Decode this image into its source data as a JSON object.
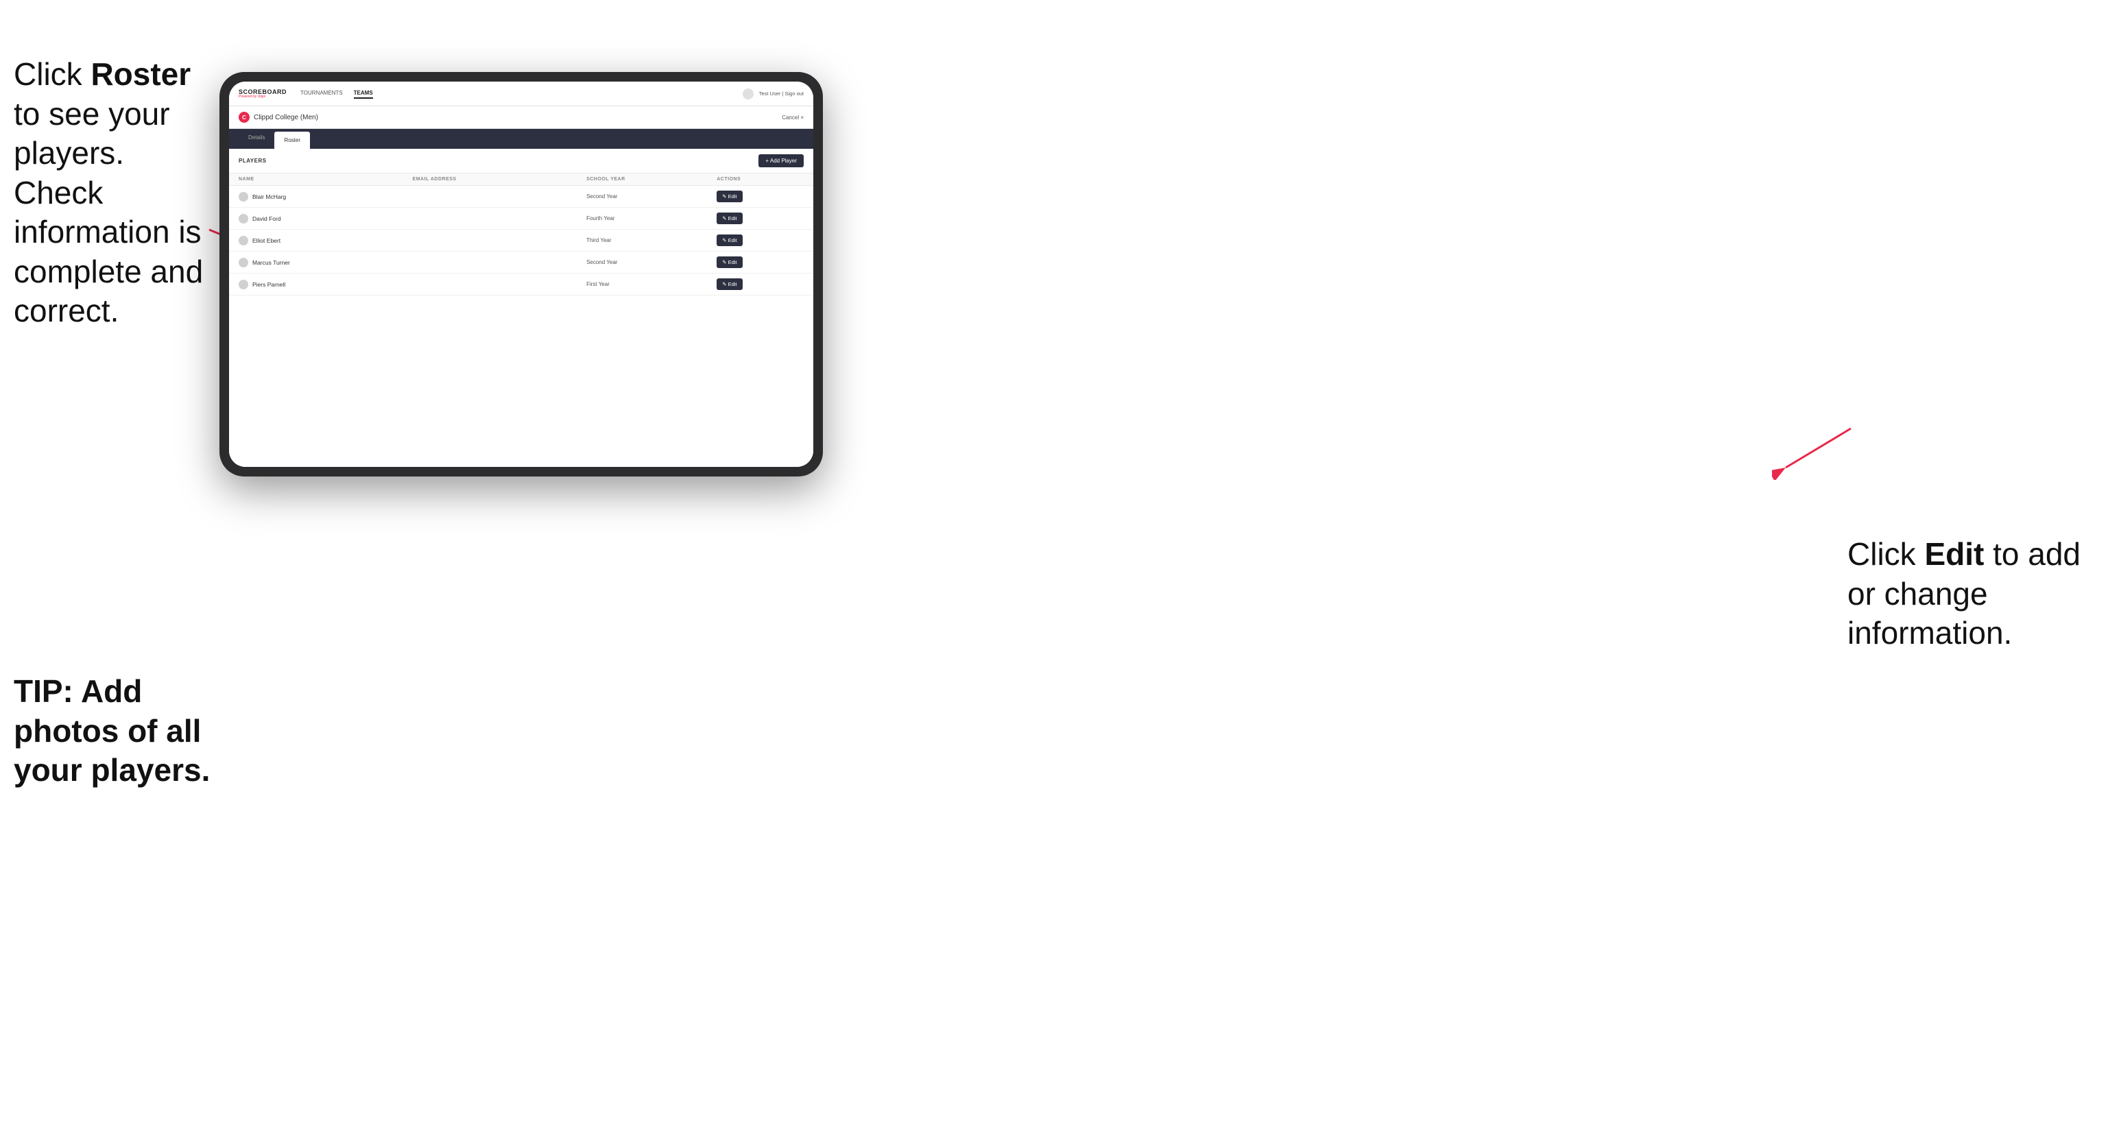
{
  "instructions": {
    "left_main": "Click ",
    "left_bold": "Roster",
    "left_rest": " to see your players. Check information is complete and correct.",
    "tip": "TIP: Add photos of all your players.",
    "right_pre": "Click ",
    "right_bold": "Edit",
    "right_rest": " to add or change information."
  },
  "navbar": {
    "brand_name": "SCOREBOARD",
    "brand_sub": "Powered by clippi",
    "nav_items": [
      {
        "label": "TOURNAMENTS",
        "active": false
      },
      {
        "label": "TEAMS",
        "active": true
      }
    ],
    "user": "Test User | Sign out"
  },
  "team": {
    "logo_letter": "C",
    "name": "Clippd College (Men)",
    "cancel_label": "Cancel ×"
  },
  "tabs": [
    {
      "label": "Details",
      "active": false
    },
    {
      "label": "Roster",
      "active": true
    }
  ],
  "players_section": {
    "section_label": "PLAYERS",
    "add_button_label": "+ Add Player",
    "table_headers": [
      "NAME",
      "EMAIL ADDRESS",
      "SCHOOL YEAR",
      "ACTIONS"
    ],
    "players": [
      {
        "name": "Blair McHarg",
        "email": "",
        "year": "Second Year"
      },
      {
        "name": "David Ford",
        "email": "",
        "year": "Fourth Year"
      },
      {
        "name": "Elliot Ebert",
        "email": "",
        "year": "Third Year"
      },
      {
        "name": "Marcus Turner",
        "email": "",
        "year": "Second Year"
      },
      {
        "name": "Piers Parnell",
        "email": "",
        "year": "First Year"
      }
    ],
    "edit_label": "✎ Edit"
  }
}
